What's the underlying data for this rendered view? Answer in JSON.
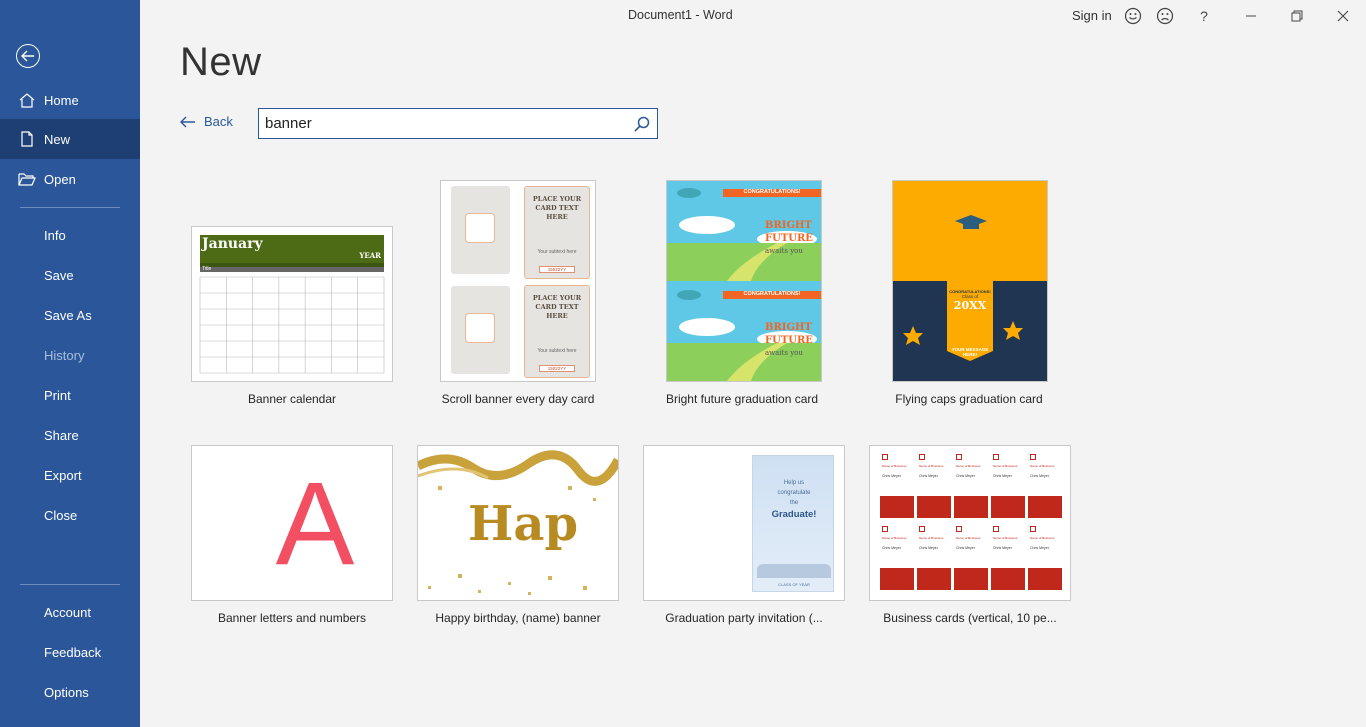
{
  "window": {
    "title": "Document1  -  Word",
    "sign_in": "Sign in",
    "help": "?"
  },
  "sidebar": {
    "items": [
      {
        "label": "Home"
      },
      {
        "label": "New"
      },
      {
        "label": "Open"
      },
      {
        "label": "Info"
      },
      {
        "label": "Save"
      },
      {
        "label": "Save As"
      },
      {
        "label": "History"
      },
      {
        "label": "Print"
      },
      {
        "label": "Share"
      },
      {
        "label": "Export"
      },
      {
        "label": "Close"
      },
      {
        "label": "Account"
      },
      {
        "label": "Feedback"
      },
      {
        "label": "Options"
      }
    ],
    "active_item": "New",
    "disabled_item": "History"
  },
  "main": {
    "heading": "New",
    "back_label": "Back",
    "search": {
      "value": "banner",
      "placeholder": ""
    }
  },
  "templates": [
    {
      "title": "Banner calendar",
      "thumb": {
        "month": "January",
        "year": "YEAR",
        "row_label": "Title"
      }
    },
    {
      "title": "Scroll banner every day card",
      "thumb": {
        "card_text": "PLACE YOUR CARD TEXT HERE",
        "subtext": "Your subtext here",
        "stamp": "15022YY"
      }
    },
    {
      "title": "Bright future graduation card",
      "thumb": {
        "ribbon": "CONGRATULATIONS!",
        "line1": "BRIGHT",
        "line2": "FUTURE",
        "line3": "awaits you"
      }
    },
    {
      "title": "Flying caps graduation card",
      "thumb": {
        "line1": "CONGRATULATIONS!",
        "line2": "Class of",
        "year": "20XX",
        "line3": "YOUR MESSAGE HERE!"
      }
    },
    {
      "title": "Banner letters and numbers",
      "thumb": {
        "letter": "A"
      }
    },
    {
      "title": "Happy birthday, (name) banner",
      "thumb": {
        "word": "Hap"
      }
    },
    {
      "title": "Graduation party invitation (...",
      "thumb": {
        "line1": "Help us",
        "line2": "congratulate",
        "line3": "the",
        "line4": "Graduate!",
        "footer": "CLASS OF YEAR"
      }
    },
    {
      "title": "Business cards (vertical, 10 pe...",
      "thumb": {
        "org": "Name of Business",
        "person": "Chris Meyer"
      }
    }
  ],
  "colors": {
    "sidebar": "#2b579a",
    "sidebar_active": "#1e3f73",
    "accent": "#2b579a",
    "banner_red": "#f24f63",
    "gold": "#b88a22",
    "card_red": "#c0281c"
  }
}
